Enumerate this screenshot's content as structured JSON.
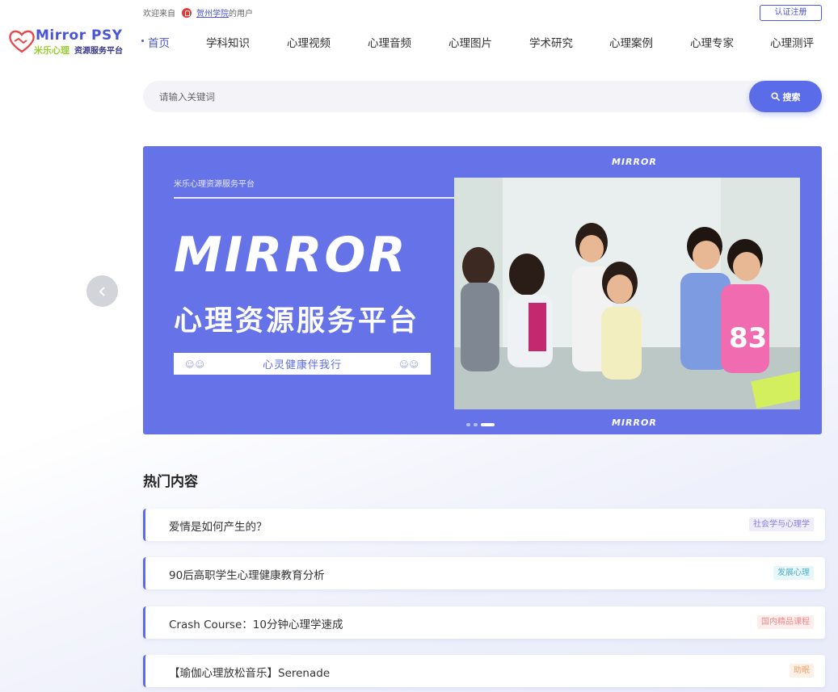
{
  "header": {
    "logo_title": "Mirror PSY",
    "logo_sub_cn": "米乐心理",
    "logo_sub_platform": "资源服务平台",
    "welcome_prefix": "欢迎来自",
    "welcome_org": "贺州学院",
    "welcome_suffix": "的用户",
    "register_label": "认证注册"
  },
  "nav": {
    "items": [
      {
        "label": "首页",
        "active": true
      },
      {
        "label": "学科知识"
      },
      {
        "label": "心理视频"
      },
      {
        "label": "心理音频"
      },
      {
        "label": "心理图片"
      },
      {
        "label": "学术研究"
      },
      {
        "label": "心理案例"
      },
      {
        "label": "心理专家"
      },
      {
        "label": "心理测评"
      }
    ]
  },
  "search": {
    "placeholder": "请输入关键词",
    "button_label": "搜索"
  },
  "banner": {
    "small_text": "米乐心理资源服务平台",
    "big_text": "MIRROR",
    "cn_text": "心理资源服务平台",
    "slogan": "心灵健康伴我行",
    "mirror_top": "MIRROR",
    "mirror_bottom": "MIRROR",
    "background_color": "#6673e8",
    "slide_count": 3,
    "active_slide": 3
  },
  "hot": {
    "title": "热门内容",
    "items": [
      {
        "title": "爱情是如何产生的？",
        "tag": "社会学与心理学",
        "tag_color": "#8a7fd8",
        "tag_bg": "#efedfb"
      },
      {
        "title": "90后高职学生心理健康教育分析",
        "tag": "发展心理",
        "tag_color": "#4fb0c6",
        "tag_bg": "#e7f6f9"
      },
      {
        "title": "Crash Course：10分钟心理学速成",
        "tag": "国内精品课程",
        "tag_color": "#ef8a8a",
        "tag_bg": "#fdeeee"
      },
      {
        "title": "【瑜伽心理放松音乐】Serenade",
        "tag": "助眠",
        "tag_color": "#f0a46a",
        "tag_bg": "#fdf1e7"
      }
    ]
  },
  "colors": {
    "accent": "#5b6ce8",
    "brand_green": "#9acd32"
  }
}
